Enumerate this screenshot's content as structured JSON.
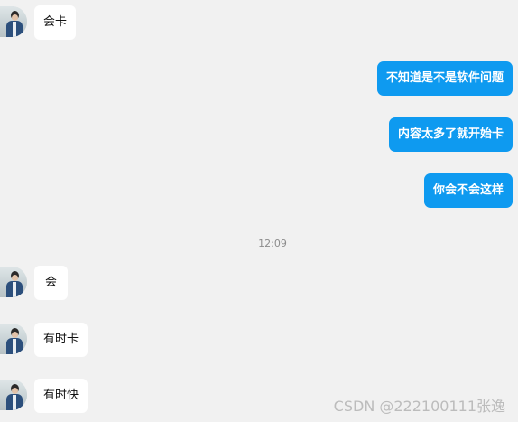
{
  "messages": [
    {
      "side": "left",
      "text": "会卡"
    },
    {
      "side": "right",
      "text": "不知道是不是软件问题"
    },
    {
      "side": "right",
      "text": "内容太多了就开始卡"
    },
    {
      "side": "right",
      "text": "你会不会这样"
    },
    {
      "side": "left",
      "text": "会"
    },
    {
      "side": "left",
      "text": "有时卡"
    },
    {
      "side": "left",
      "text": "有时快"
    }
  ],
  "timestamp": "12:09",
  "watermark": "CSDN @222100111张逸",
  "colors": {
    "background": "#f1f1f1",
    "incoming_bubble": "#ffffff",
    "outgoing_bubble": "#0e9af0"
  }
}
